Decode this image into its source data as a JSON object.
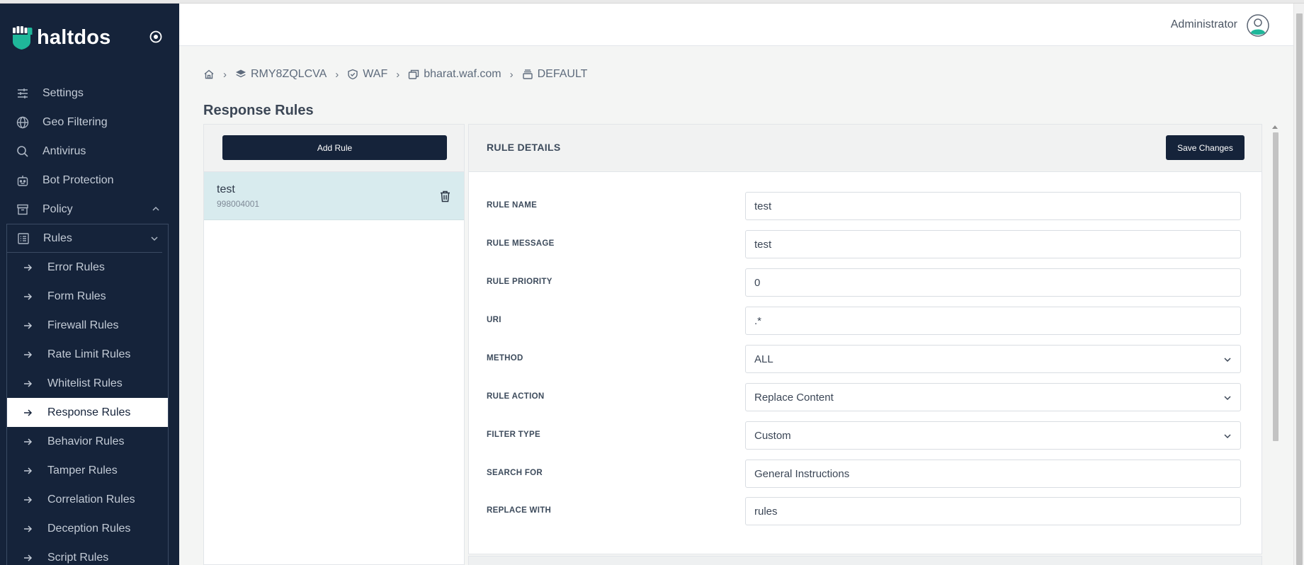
{
  "brand": {
    "name": "haltdos"
  },
  "sidebar": {
    "items": [
      {
        "label": "Settings",
        "icon": "sliders-icon"
      },
      {
        "label": "Geo Filtering",
        "icon": "globe-icon"
      },
      {
        "label": "Antivirus",
        "icon": "search-icon"
      },
      {
        "label": "Bot Protection",
        "icon": "robot-icon"
      },
      {
        "label": "Policy",
        "icon": "archive-icon"
      }
    ],
    "rules_group": {
      "label": "Rules",
      "icon": "list-icon",
      "items": [
        "Error Rules",
        "Form Rules",
        "Firewall Rules",
        "Rate Limit Rules",
        "Whitelist Rules",
        "Response Rules",
        "Behavior Rules",
        "Tamper Rules",
        "Correlation Rules",
        "Deception Rules",
        "Script Rules"
      ],
      "active": "Response Rules"
    }
  },
  "header": {
    "user": "Administrator"
  },
  "breadcrumb": {
    "items": [
      {
        "label": "",
        "icon": "home-icon"
      },
      {
        "label": "RMY8ZQLCVA",
        "icon": "layers-icon"
      },
      {
        "label": "WAF",
        "icon": "shield-check-icon"
      },
      {
        "label": "bharat.waf.com",
        "icon": "windows-icon"
      },
      {
        "label": "DEFAULT",
        "icon": "stack-icon"
      }
    ],
    "separator": "›"
  },
  "page": {
    "title": "Response Rules"
  },
  "rule_list": {
    "add_label": "Add Rule",
    "rules": [
      {
        "name": "test",
        "id": "998004001"
      }
    ]
  },
  "details": {
    "title": "RULE DETAILS",
    "save_label": "Save Changes",
    "fields": {
      "rule_name": {
        "label": "RULE NAME",
        "value": "test"
      },
      "rule_message": {
        "label": "RULE MESSAGE",
        "value": "test"
      },
      "rule_priority": {
        "label": "RULE PRIORITY",
        "value": "0"
      },
      "uri": {
        "label": "URI",
        "value": ".*"
      },
      "method": {
        "label": "METHOD",
        "value": "ALL"
      },
      "rule_action": {
        "label": "RULE ACTION",
        "value": "Replace Content"
      },
      "filter_type": {
        "label": "FILTER TYPE",
        "value": "Custom"
      },
      "search_for": {
        "label": "SEARCH FOR",
        "value": "General Instructions"
      },
      "replace_with": {
        "label": "REPLACE WITH",
        "value": "rules"
      }
    }
  },
  "colors": {
    "sidebar_bg": "#15233a",
    "accent_teal": "#1fb79a",
    "active_row": "#d8ebee",
    "button_bg": "#15233a"
  }
}
